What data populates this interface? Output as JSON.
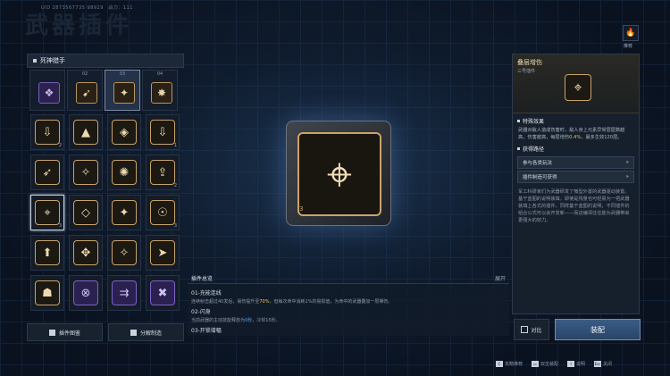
{
  "watermark": "武器插件",
  "uid_text": "UID 2873567735 98929　战力：111",
  "left_panel": {
    "title": "死神猎手",
    "tabs": [
      {
        "num": "",
        "icon": "❖",
        "purple": true
      },
      {
        "num": "02",
        "icon": "➹",
        "purple": false
      },
      {
        "num": "03",
        "icon": "✦",
        "purple": false
      },
      {
        "num": "04",
        "icon": "✸",
        "purple": false
      }
    ],
    "grid": [
      {
        "icon": "⇩",
        "lvl": "2"
      },
      {
        "icon": "▲",
        "lvl": ""
      },
      {
        "icon": "◈",
        "lvl": ""
      },
      {
        "icon": "⇩",
        "lvl": "1"
      },
      {
        "icon": "➶",
        "lvl": ""
      },
      {
        "icon": "✧",
        "lvl": ""
      },
      {
        "icon": "✺",
        "lvl": ""
      },
      {
        "icon": "⇪",
        "lvl": "2"
      },
      {
        "icon": "⌖",
        "lvl": "3"
      },
      {
        "icon": "◇",
        "lvl": ""
      },
      {
        "icon": "✦",
        "lvl": ""
      },
      {
        "icon": "☉",
        "lvl": "3"
      },
      {
        "icon": "⬆",
        "lvl": ""
      },
      {
        "icon": "✥",
        "lvl": ""
      },
      {
        "icon": "✧",
        "lvl": ""
      },
      {
        "icon": "➤",
        "lvl": ""
      },
      {
        "icon": "☗",
        "lvl": ""
      },
      {
        "icon": "⊗",
        "lvl": "",
        "purple": true
      },
      {
        "icon": "⇉",
        "lvl": "",
        "purple": true
      },
      {
        "icon": "✖",
        "lvl": "",
        "purple": true
      }
    ],
    "btn_gallery": "插件图鉴",
    "btn_dismantle": "分解制造"
  },
  "center": {
    "chip_icon": "⌖",
    "chip_num": "3"
  },
  "overview": {
    "title": "插件总览",
    "expand": "展开",
    "items": [
      {
        "title": "01-充能连线",
        "desc_a": "连续射击超过40发后，易伤提升至",
        "desc_hl": "70%",
        "desc_b": "，但每次命中消耗1%的易损值，为命中的武器叠加一层裸伤。"
      },
      {
        "title": "02-闪身",
        "desc_a": "当前武器的主动技能释放为",
        "desc_hl": "0秒",
        "desc_b": "，冷却15秒。"
      },
      {
        "title": "03-开锁增幅",
        "desc_a": "",
        "desc_hl": "",
        "desc_b": ""
      }
    ]
  },
  "right_panel": {
    "top_label": "推荐",
    "name": "叠层增伤",
    "subtitle": "三号插件",
    "chip_icon": "⌖",
    "effect_title": "特殊效果",
    "effect_text_a": "武器对敌人造成伤害时，敌人身上元素异常层层数越高，伤害越高，每层增伤",
    "effect_hl": "0.4%",
    "effect_text_b": "，最多生效120层。",
    "source_title": "获得路径",
    "links": [
      "参与各类玩法",
      "插件制造可获得"
    ],
    "bottom_text": "军工科研家们为武器研发了微型外置的武器驱动装置。基于蓝图的说明装填，即使是残量也可轻易为一把武器装填上各式的插件。同样基于蓝图的说明，不同插件的组合公式可以会开发新——而这编译往往能为武器带来更强大的效力。",
    "compare": "对比",
    "equip": "装配"
  },
  "footer": [
    {
      "key": "C",
      "label": "攻略推荐"
    },
    {
      "key": "▭",
      "label": "双击装配"
    },
    {
      "key": "I",
      "label": "说明"
    },
    {
      "key": "Esc",
      "label": "关闭"
    }
  ]
}
